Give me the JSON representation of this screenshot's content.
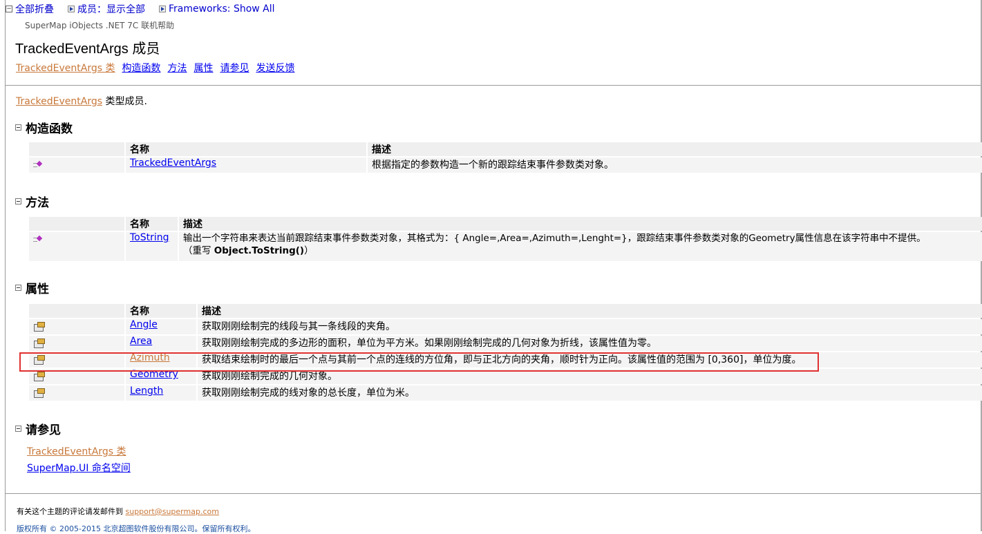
{
  "toolbar": {
    "collapse_all": "全部折叠",
    "members_filter": "成员：显示全部",
    "frameworks_filter": "Frameworks: Show All"
  },
  "header": {
    "subtitle": "SuperMap iObjects .NET 7C 联机帮助",
    "title": "TrackedEventArgs 成员",
    "nav": [
      "TrackedEventArgs 类",
      "构造函数",
      "方法",
      "属性",
      "请参见",
      "发送反馈"
    ]
  },
  "intro": {
    "link": "TrackedEventArgs",
    "text": " 类型成员."
  },
  "constructors": {
    "heading": "构造函数",
    "columns": [
      "名称",
      "描述"
    ],
    "rows": [
      {
        "name": "TrackedEventArgs",
        "desc": "根据指定的参数构造一个新的跟踪结束事件参数类对象。"
      }
    ]
  },
  "methods": {
    "heading": "方法",
    "columns": [
      "名称",
      "描述"
    ],
    "rows": [
      {
        "name": "ToString",
        "desc": "输出一个字符串来表达当前跟踪结束事件参数类对象，其格式为：{ Angle=,Area=,Azimuth=,Lenght=}，跟踪结束事件参数类对象的Geometry属性信息在该字符串中不提供。",
        "override_prefix": "（重写 ",
        "override_name": "Object.ToString()",
        "override_suffix": "）"
      }
    ]
  },
  "properties": {
    "heading": "属性",
    "columns": [
      "名称",
      "描述"
    ],
    "rows": [
      {
        "name": "Angle",
        "desc": "获取刚刚绘制完的线段与其一条线段的夹角。"
      },
      {
        "name": "Area",
        "desc": "获取刚刚绘制完成的多边形的面积，单位为平方米。如果刚刚绘制完成的几何对象为折线，该属性值为零。"
      },
      {
        "name": "Azimuth",
        "desc": "获取结束绘制时的最后一个点与其前一个点的连线的方位角，即与正北方向的夹角，顺时针为正向。该属性值的范围为 [0,360]，单位为度。"
      },
      {
        "name": "Geometry",
        "desc": "获取刚刚绘制完成的几何对象。"
      },
      {
        "name": "Length",
        "desc": "获取刚刚绘制完成的线对象的总长度，单位为米。"
      }
    ]
  },
  "see_also": {
    "heading": "请参见",
    "links": [
      "TrackedEventArgs 类",
      "SuperMap.UI 命名空间"
    ]
  },
  "footer": {
    "feedback_prefix": "有关这个主题的评论请发邮件到 ",
    "email": "support@supermap.com",
    "copyright": "版权所有 © 2005-2015 北京超图软件股份有限公司。保留所有权利。"
  },
  "colors": {
    "highlight": "#e03030",
    "link": "#0000ee",
    "visited_link": "#c8783a"
  }
}
